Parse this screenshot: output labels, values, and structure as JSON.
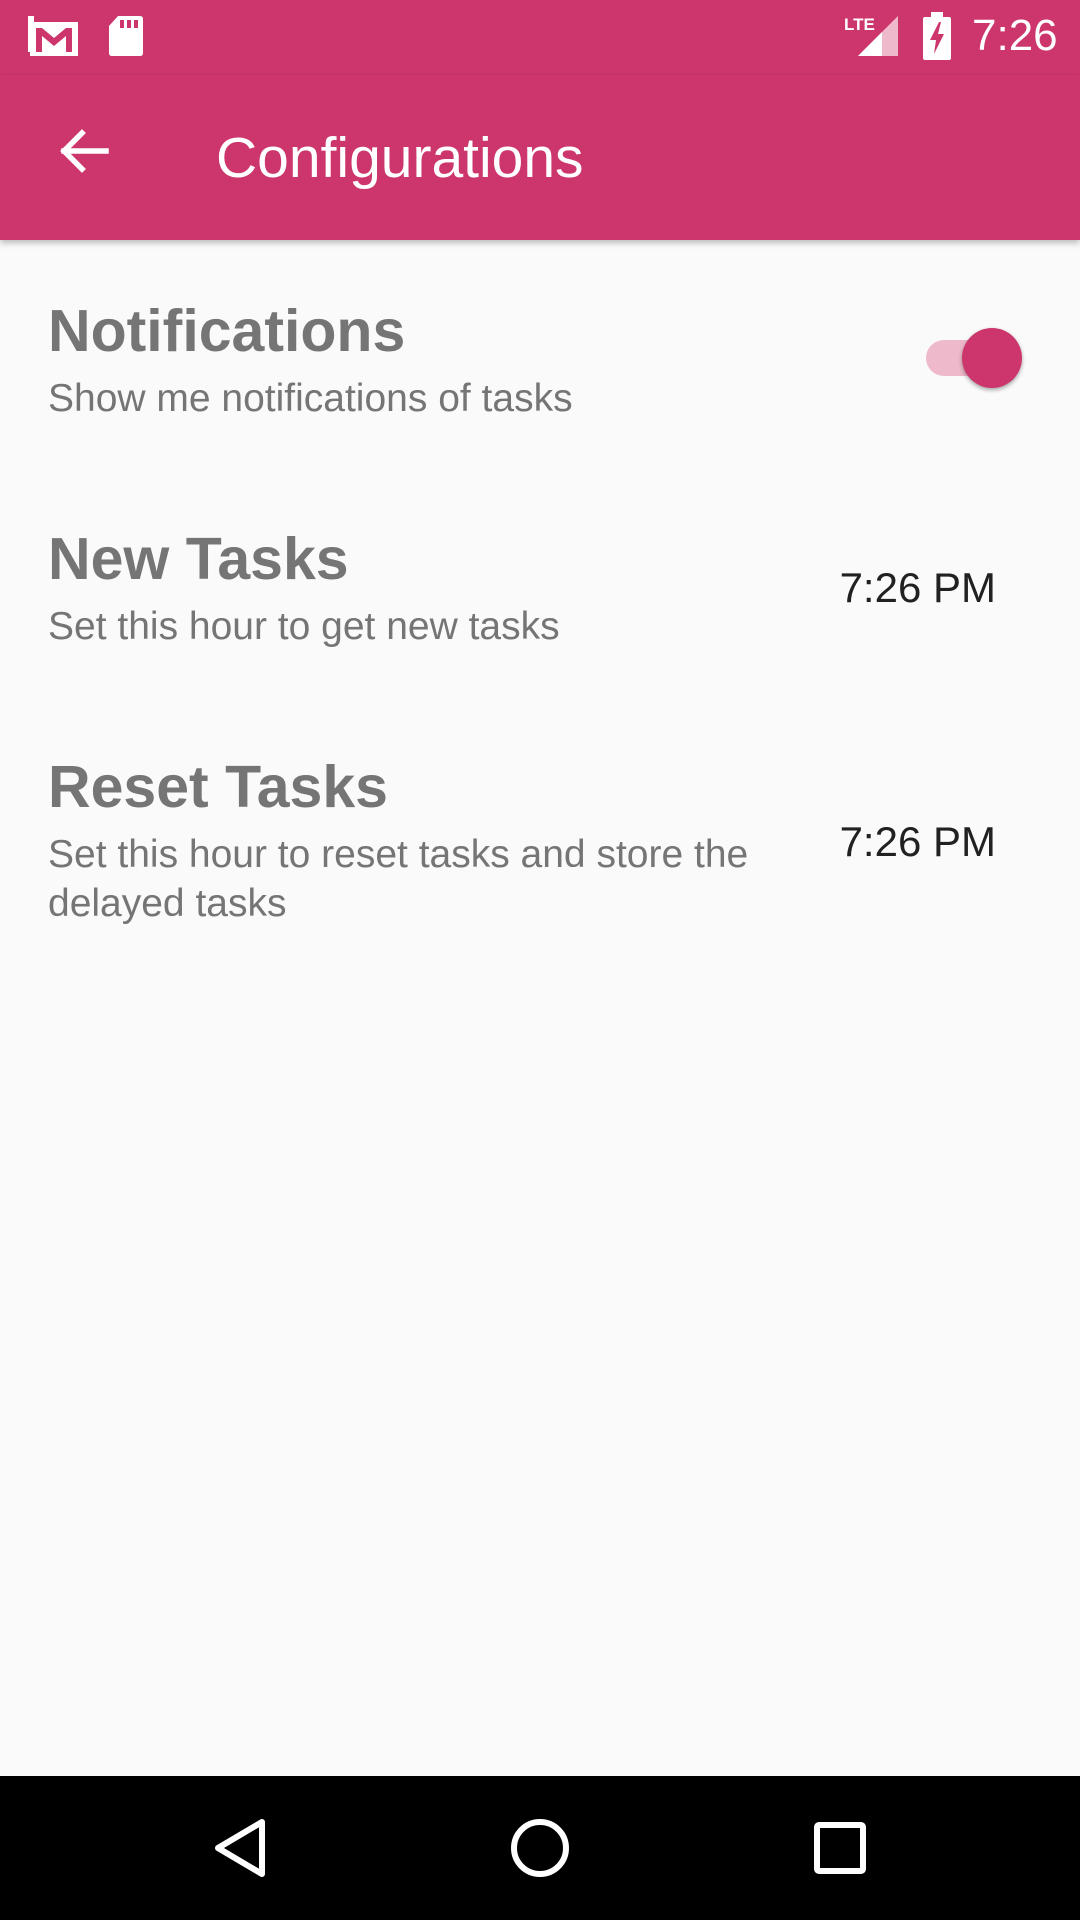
{
  "status_bar": {
    "time": "7:26",
    "network": "LTE",
    "icons": [
      "gmail-icon",
      "sd-card-icon",
      "signal-icon",
      "battery-charging-icon"
    ]
  },
  "app_bar": {
    "title": "Configurations",
    "back_icon": "arrow-back-icon"
  },
  "settings": {
    "notifications": {
      "title": "Notifications",
      "description": "Show me notifications of tasks",
      "enabled": true
    },
    "new_tasks": {
      "title": "New Tasks",
      "description": "Set this hour to get new tasks",
      "time": "7:26 PM"
    },
    "reset_tasks": {
      "title": "Reset Tasks",
      "description": "Set this hour to reset tasks and store the delayed tasks",
      "time": "7:26 PM"
    }
  },
  "nav_bar": {
    "icons": [
      "back-triangle-icon",
      "home-circle-icon",
      "recents-square-icon"
    ]
  },
  "colors": {
    "primary": "#cc366c",
    "switch_track": "#eebacb",
    "title_text": "#757575",
    "time_text": "#212121",
    "background": "#fafafa"
  }
}
